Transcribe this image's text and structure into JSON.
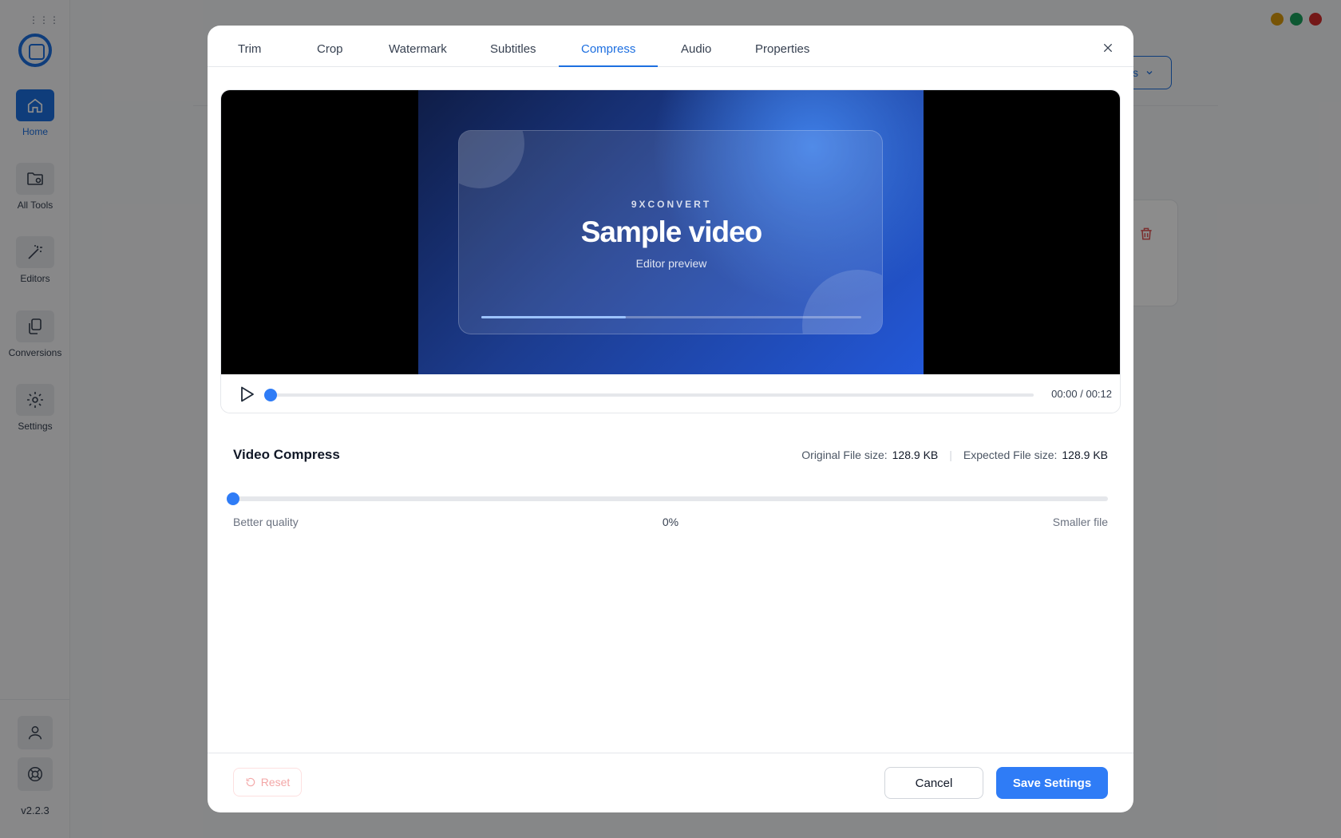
{
  "app": {
    "version": "v2.2.3",
    "nav": [
      {
        "label": "Home",
        "icon": "home-icon",
        "active": true
      },
      {
        "label": "All Tools",
        "icon": "folder-settings-icon",
        "active": false
      },
      {
        "label": "Editors",
        "icon": "magic-wand-icon",
        "active": false
      },
      {
        "label": "Conversions",
        "icon": "copy-icon",
        "active": false
      },
      {
        "label": "Settings",
        "icon": "gear-icon",
        "active": false
      }
    ],
    "bottom_icons": [
      "user-icon",
      "lifebuoy-icon"
    ],
    "window_dots": [
      "#d99a0c",
      "#19a05c",
      "#d42c2c"
    ],
    "header_button_label": "s"
  },
  "modal": {
    "tabs": [
      "Trim",
      "Crop",
      "Watermark",
      "Subtitles",
      "Compress",
      "Audio",
      "Properties"
    ],
    "active_tab": "Compress",
    "video": {
      "brand": "9XCONVERT",
      "title": "Sample video",
      "subtitle": "Editor preview",
      "frame_progress": 0.38,
      "seek_progress": 0,
      "time": "00:00 / 00:12"
    },
    "compress": {
      "title": "Video Compress",
      "original_label": "Original File size:",
      "original_value": "128.9 KB",
      "expected_label": "Expected File size:",
      "expected_value": "128.9 KB",
      "level": 0,
      "level_text": "0%",
      "left_label": "Better quality",
      "right_label": "Smaller file"
    },
    "footer": {
      "reset": "Reset",
      "cancel": "Cancel",
      "save": "Save Settings"
    }
  },
  "colors": {
    "accent": "#2f7cf6",
    "danger": "#e05252"
  }
}
